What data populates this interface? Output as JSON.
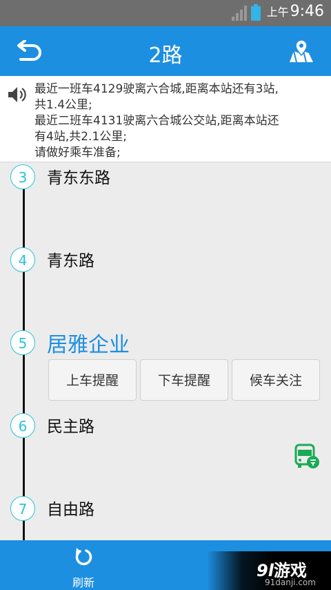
{
  "status_bar": {
    "ampm": "上午",
    "time": "9:46"
  },
  "header": {
    "title": "2路"
  },
  "notice": {
    "lines": [
      "最近一班车4129驶离六合城,距离本站还有3站,",
      "共1.4公里;",
      "最近二班车4131驶离六合城公交站,距离本站还",
      "有4站,共2.1公里;",
      "请做好乘车准备;"
    ]
  },
  "stops": [
    {
      "num": "3",
      "name": "青东东路"
    },
    {
      "num": "4",
      "name": "青东路"
    },
    {
      "num": "5",
      "name": "居雅企业"
    },
    {
      "num": "6",
      "name": "民主路"
    },
    {
      "num": "7",
      "name": "自由路"
    }
  ],
  "actions": {
    "board": "上车提醒",
    "alight": "下车提醒",
    "follow": "候车关注"
  },
  "bottom": {
    "refresh": "刷新"
  },
  "watermark": {
    "brand_num": "9l",
    "brand_text": "游戏",
    "site": "91danji.com"
  },
  "colors": {
    "primary": "#1d8fe1",
    "accent": "#27c3da",
    "bus": "#1aaa55"
  }
}
